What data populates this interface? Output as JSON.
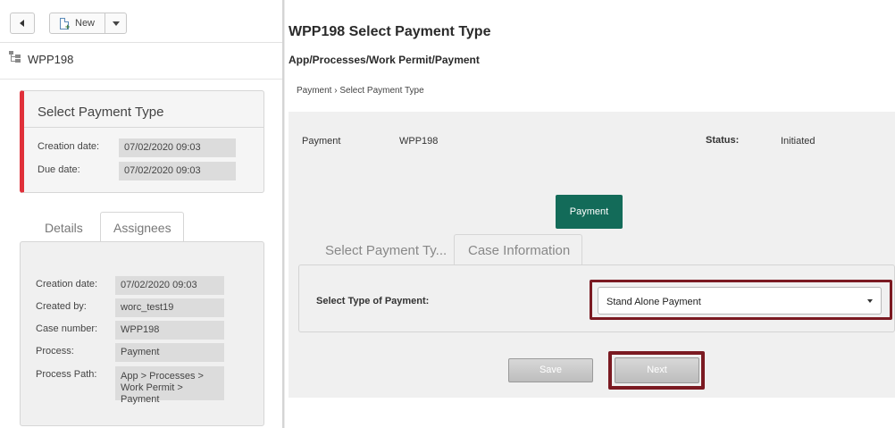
{
  "toolbar": {
    "new_label": "New"
  },
  "case": {
    "id": "WPP198"
  },
  "task": {
    "title": "Select Payment Type",
    "creation_label": "Creation date:",
    "creation_value": "07/02/2020 09:03",
    "due_label": "Due date:",
    "due_value": "07/02/2020 09:03"
  },
  "left_tabs": {
    "details": "Details",
    "assignees": "Assignees"
  },
  "details": {
    "rows": [
      {
        "label": "Creation date:",
        "value": "07/02/2020 09:03"
      },
      {
        "label": "Created by:",
        "value": "worc_test19"
      },
      {
        "label": "Case number:",
        "value": "WPP198"
      },
      {
        "label": "Process:",
        "value": "Payment"
      },
      {
        "label": "Process Path:",
        "value": "App > Processes >",
        "value2": "Work Permit > Payment"
      }
    ]
  },
  "header": {
    "title": "WPP198 Select Payment Type",
    "path": "App/Processes/Work Permit/Payment",
    "breadcrumb": "Payment › Select Payment Type"
  },
  "info": {
    "process_label": "Payment",
    "case_number": "WPP198",
    "status_label": "Status:",
    "status_value": "Initiated"
  },
  "stage": {
    "label": "Payment",
    "color": "#136b59"
  },
  "form_tabs": {
    "select_payment": "Select Payment Ty...",
    "case_information": "Case Information"
  },
  "form": {
    "label": "Select Type of Payment:",
    "selected": "Stand Alone Payment"
  },
  "actions": {
    "save": "Save",
    "next": "Next"
  },
  "colors": {
    "accent_red": "#e0303a",
    "highlight": "#7b1a22"
  }
}
